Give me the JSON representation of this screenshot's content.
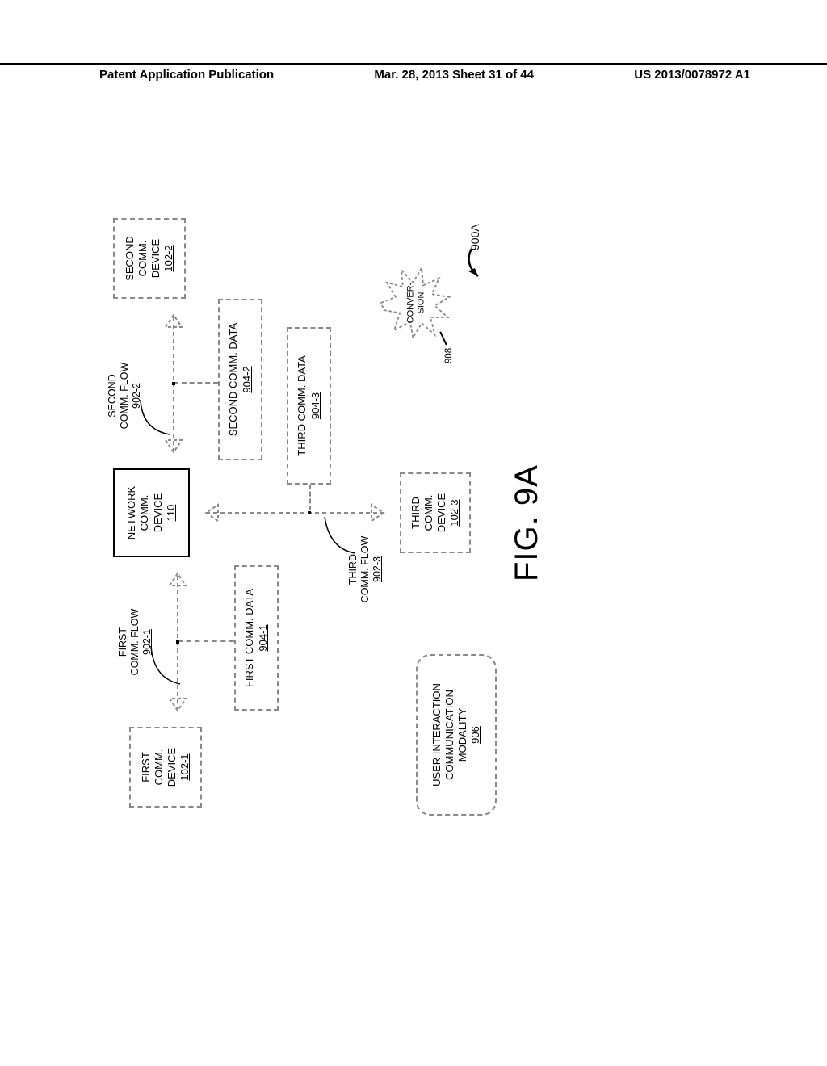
{
  "header": {
    "left": "Patent Application Publication",
    "center": "Mar. 28, 2013  Sheet 31 of 44",
    "right": "US 2013/0078972 A1"
  },
  "boxes": {
    "first_device": {
      "l1": "FIRST",
      "l2": "COMM.",
      "l3": "DEVICE",
      "ref": "102-1"
    },
    "second_device": {
      "l1": "SECOND",
      "l2": "COMM.",
      "l3": "DEVICE",
      "ref": "102-2"
    },
    "third_device": {
      "l1": "THIRD",
      "l2": "COMM.",
      "l3": "DEVICE",
      "ref": "102-3"
    },
    "network_device": {
      "l1": "NETWORK",
      "l2": "COMM.",
      "l3": "DEVICE",
      "ref": "110"
    },
    "first_data": {
      "l1": "FIRST COMM. DATA",
      "ref": "904-1"
    },
    "second_data": {
      "l1": "SECOND COMM. DATA",
      "ref": "904-2"
    },
    "third_data": {
      "l1": "THIRD COMM. DATA",
      "ref": "904-3"
    },
    "modality": {
      "l1": "USER INTERACTION",
      "l2": "COMMUNICATION",
      "l3": "MODALITY",
      "ref": "906"
    }
  },
  "flows": {
    "first": {
      "l1": "FIRST",
      "l2": "COMM. FLOW",
      "ref": "902-1"
    },
    "second": {
      "l1": "SECOND",
      "l2": "COMM. FLOW",
      "ref": "902-2"
    },
    "third": {
      "l1": "THIRD",
      "l2": "COMM. FLOW",
      "ref": "902-3"
    }
  },
  "star": {
    "l1": "CONVER-",
    "l2": "SION",
    "ref": "908"
  },
  "figure_ref": "900A",
  "figure_caption": "FIG. 9A"
}
